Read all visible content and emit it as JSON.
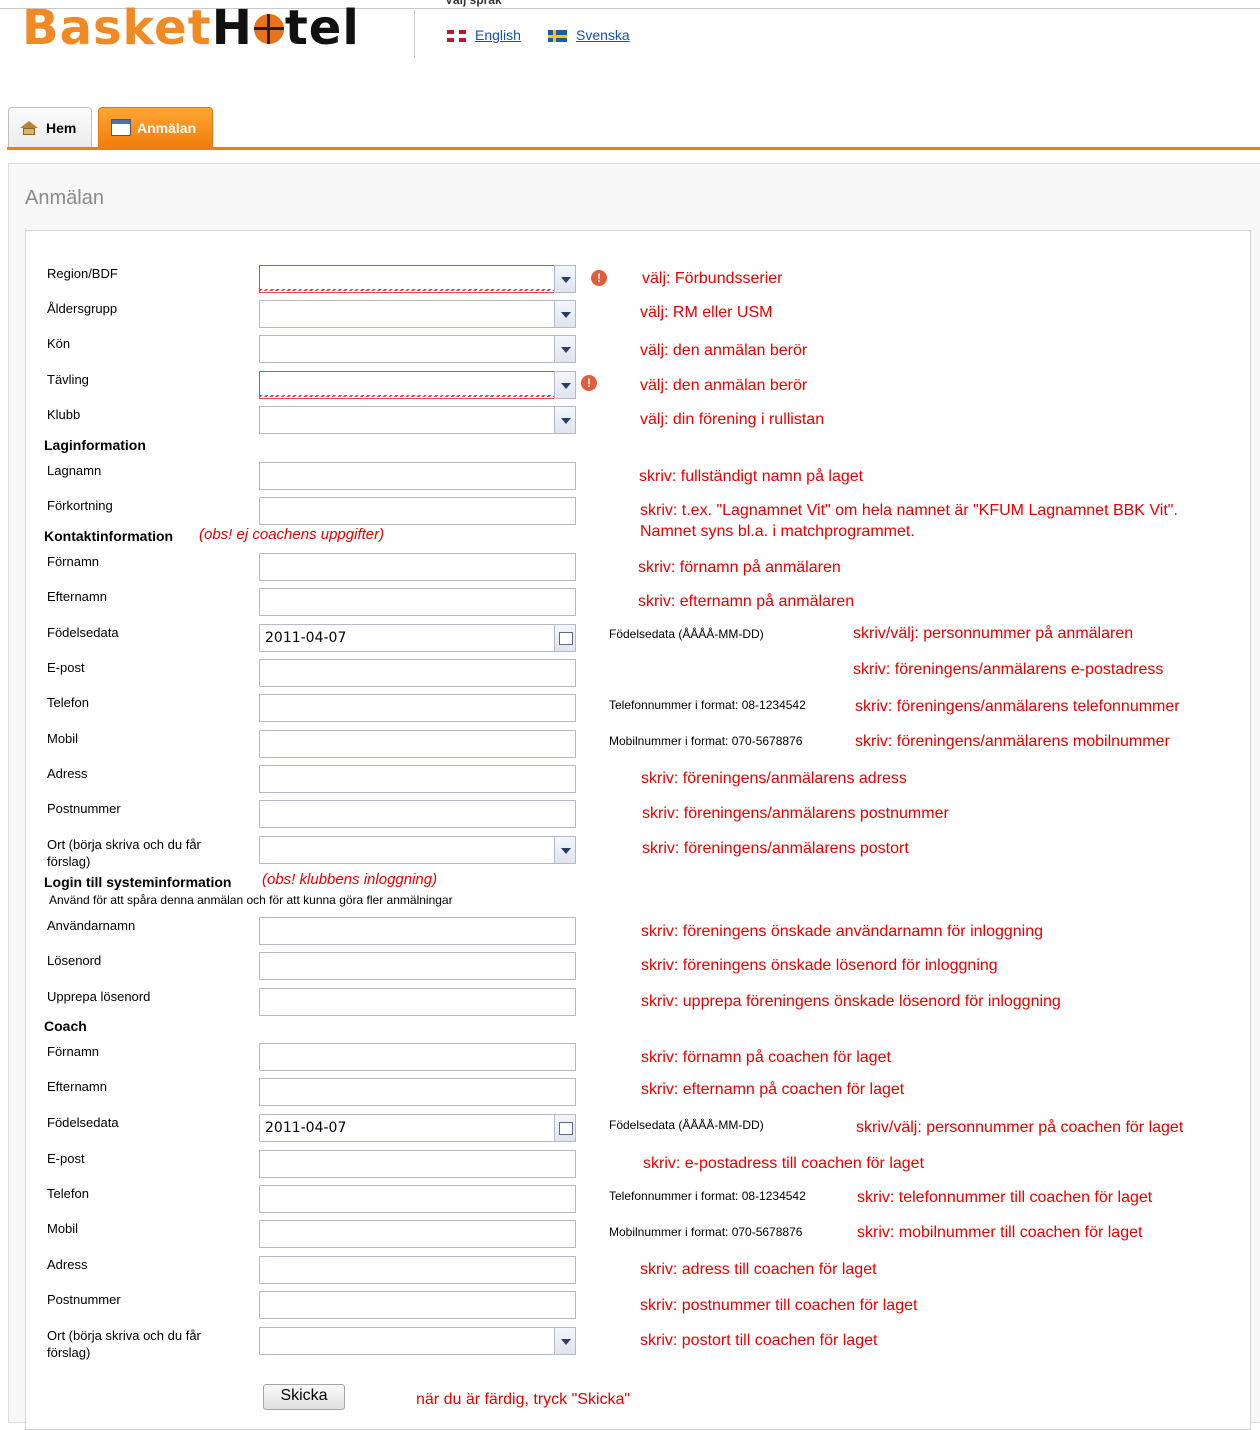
{
  "header": {
    "logo_left": "Basket",
    "logo_right_a": "H",
    "logo_right_b": "tel",
    "language_heading": "Välj språk",
    "languages": [
      {
        "label": "English",
        "flag": "uk-flag-icon"
      },
      {
        "label": "Svenska",
        "flag": "se-flag-icon"
      }
    ]
  },
  "tabs": [
    {
      "label": "Hem",
      "icon": "home-icon",
      "active": false
    },
    {
      "label": "Anmälan",
      "icon": "calendar-icon",
      "active": true
    }
  ],
  "page": {
    "title": "Anmälan"
  },
  "sections": {
    "laginformation": "Laginformation",
    "kontakt": "Kontaktinformation",
    "kontakt_obs": "(obs! ej coachens uppgifter)",
    "login": "Login till systeminformation",
    "login_obs": "(obs! klubbens inloggning)",
    "login_sub": "Använd för att spåra denna anmälan och för att kunna göra fler anmälningar",
    "coach": "Coach"
  },
  "fields": {
    "region": {
      "label": "Region/BDF",
      "value": ""
    },
    "aldersgrupp": {
      "label": "Åldersgrupp",
      "value": ""
    },
    "kon": {
      "label": "Kön",
      "value": ""
    },
    "tavling": {
      "label": "Tävling",
      "value": ""
    },
    "klubb": {
      "label": "Klubb",
      "value": ""
    },
    "lagnamn": {
      "label": "Lagnamn",
      "value": ""
    },
    "forkortning": {
      "label": "Förkortning",
      "value": ""
    },
    "k_fornamn": {
      "label": "Förnamn",
      "value": ""
    },
    "k_efternamn": {
      "label": "Efternamn",
      "value": ""
    },
    "k_fodelsedata": {
      "label": "Födelsedata",
      "value": "2011-04-07",
      "hint": "Födelsedata (ÅÅÅÅ-MM-DD)"
    },
    "k_epost": {
      "label": "E-post",
      "value": ""
    },
    "k_telefon": {
      "label": "Telefon",
      "value": "",
      "hint": "Telefonnummer i format: 08-1234542"
    },
    "k_mobil": {
      "label": "Mobil",
      "value": "",
      "hint": "Mobilnummer i format: 070-5678876"
    },
    "k_adress": {
      "label": "Adress",
      "value": ""
    },
    "k_postnummer": {
      "label": "Postnummer",
      "value": ""
    },
    "k_ort": {
      "label_1": "Ort (börja skriva och du får",
      "label_2": "förslag)",
      "value": ""
    },
    "anvandarnamn": {
      "label": "Användarnamn",
      "value": ""
    },
    "losenord": {
      "label": "Lösenord",
      "value": ""
    },
    "upprepa": {
      "label": "Upprepa lösenord",
      "value": ""
    },
    "c_fornamn": {
      "label": "Förnamn",
      "value": ""
    },
    "c_efternamn": {
      "label": "Efternamn",
      "value": ""
    },
    "c_fodelsedata": {
      "label": "Födelsedata",
      "value": "2011-04-07",
      "hint": "Födelsedata (ÅÅÅÅ-MM-DD)"
    },
    "c_epost": {
      "label": "E-post",
      "value": ""
    },
    "c_telefon": {
      "label": "Telefon",
      "value": "",
      "hint": "Telefonnummer i format: 08-1234542"
    },
    "c_mobil": {
      "label": "Mobil",
      "value": "",
      "hint": "Mobilnummer i format: 070-5678876"
    },
    "c_adress": {
      "label": "Adress",
      "value": ""
    },
    "c_postnummer": {
      "label": "Postnummer",
      "value": ""
    },
    "c_ort": {
      "label_1": "Ort (börja skriva och du får",
      "label_2": "förslag)",
      "value": ""
    }
  },
  "notes": {
    "region": "välj:  Förbundsserier",
    "aldersgrupp": "välj: RM eller USM",
    "kon": "välj: den anmälan berör",
    "tavling": "välj: den anmälan berör",
    "klubb": "välj: din förening i rullistan",
    "lagnamn": "skriv: fullständigt namn på laget",
    "forkortning_1": "skriv: t.ex. \"Lagnamnet Vit\" om hela namnet är \"KFUM Lagnamnet BBK Vit\".",
    "forkortning_2": "Namnet syns bl.a. i matchprogrammet.",
    "k_fornamn": "skriv: förnamn på anmälaren",
    "k_efternamn": "skriv: efternamn på anmälaren",
    "k_fodelsedata": "skriv/välj: personnummer på anmälaren",
    "k_epost": "skriv: föreningens/anmälarens e-postadress",
    "k_telefon": "skriv: föreningens/anmälarens telefonnummer",
    "k_mobil": "skriv: föreningens/anmälarens mobilnummer",
    "k_adress": "skriv: föreningens/anmälarens adress",
    "k_postnummer": "skriv: föreningens/anmälarens postnummer",
    "k_ort": "skriv: föreningens/anmälarens postort",
    "anvandarnamn": "skriv: föreningens önskade användarnamn för inloggning",
    "losenord": "skriv: föreningens önskade lösenord för inloggning",
    "upprepa": "skriv: upprepa föreningens önskade lösenord för inloggning",
    "c_fornamn": "skriv: förnamn på coachen för laget",
    "c_efternamn": "skriv: efternamn på coachen för laget",
    "c_fodelsedata": "skriv/välj: personnummer på coachen för laget",
    "c_epost": "skriv: e-postadress till coachen för laget",
    "c_telefon": "skriv: telefonnummer till coachen för laget",
    "c_mobil": "skriv: mobilnummer till coachen för laget",
    "c_adress": "skriv: adress till coachen för laget",
    "c_postnummer": "skriv: postnummer till coachen för laget",
    "c_ort": "skriv: postort till coachen för laget",
    "submit": "när du är färdig, tryck \"Skicka\""
  },
  "submit_label": "Skicka",
  "colors": {
    "accent": "#f07e0c",
    "note_red": "#e80000",
    "link": "#1a4fb5"
  }
}
